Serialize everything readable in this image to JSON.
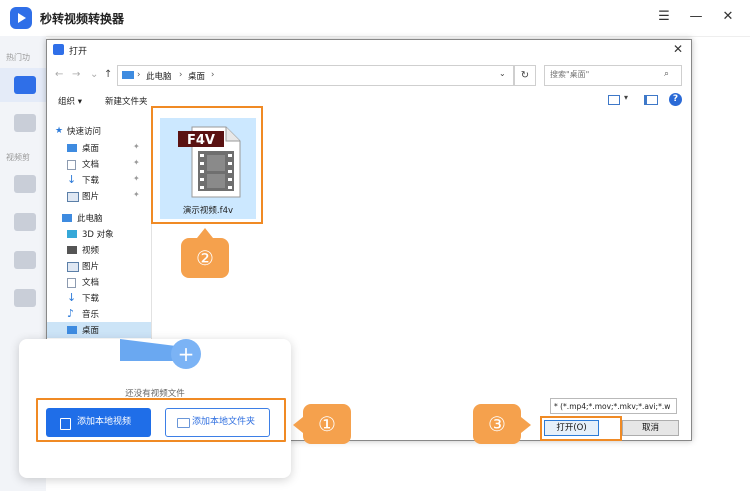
{
  "app": {
    "title": "秒转视频转换器",
    "sidebar": {
      "section1": "热门功",
      "section2": "视频剪"
    },
    "window_controls": {
      "menu": "☰",
      "minimize": "—",
      "close": "✕"
    }
  },
  "dialog": {
    "title": "打开",
    "close": "✕",
    "nav": {
      "back": "←",
      "forward": "→",
      "recent": "⌄",
      "up": "↑"
    },
    "breadcrumb": [
      "此电脑",
      "桌面"
    ],
    "breadcrumb_sep": "›",
    "refresh": "↻",
    "search_placeholder": "搜索\"桌面\"",
    "toolbar": {
      "organize": "组织 ▾",
      "new_folder": "新建文件夹",
      "help": "?"
    },
    "tree": {
      "quick_access": "快速访问",
      "quick_items": [
        {
          "label": "桌面",
          "color": "#3e8be0"
        },
        {
          "label": "文档",
          "color": "#8d9bb0"
        },
        {
          "label": "下载",
          "color": "#2c7ad9"
        },
        {
          "label": "图片",
          "color": "#5b7fa8"
        }
      ],
      "pin": "✦",
      "this_pc": "此电脑",
      "pc_items": [
        {
          "label": "3D 对象",
          "color": "#35a8d8"
        },
        {
          "label": "视频",
          "color": "#555555"
        },
        {
          "label": "图片",
          "color": "#5b7fa8"
        },
        {
          "label": "文档",
          "color": "#8d9bb0"
        },
        {
          "label": "下载",
          "color": "#2c7ad9"
        },
        {
          "label": "音乐",
          "color": "#2c7ad9"
        },
        {
          "label": "桌面",
          "color": "#3e8be0"
        }
      ]
    },
    "file": {
      "name": "演示视频.f4v",
      "badge": "F4V"
    },
    "file_type": "* (*.mp4;*.mov;*.mkv;*.avi;*.w",
    "open_button": "打开(O)",
    "cancel_button": "取消"
  },
  "card": {
    "empty_text": "还没有视频文件",
    "add_local_video": "添加本地视频",
    "add_local_folder": "添加本地文件夹",
    "plus": "+"
  },
  "callouts": {
    "one": "①",
    "two": "②",
    "three": "③"
  },
  "colors": {
    "accent": "#2f6fe8",
    "highlight": "#f08a24",
    "callout": "#f5a14d"
  }
}
